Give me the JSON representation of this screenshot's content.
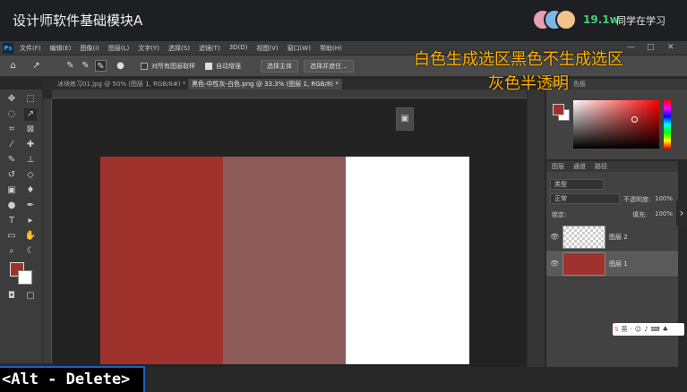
{
  "course": {
    "title": "设计师软件基础模块A"
  },
  "viewers": {
    "count": "19.1w",
    "label": "同学在学习"
  },
  "menu": {
    "logo": "Ps",
    "items": [
      "文件(F)",
      "编辑(E)",
      "图像(I)",
      "图层(L)",
      "文字(Y)",
      "选择(S)",
      "滤镜(T)",
      "3D(D)",
      "视图(V)",
      "窗口(W)",
      "帮助(H)"
    ]
  },
  "options": {
    "sample_all_layers": "对所有图层取样",
    "auto_enhance": "自动增强",
    "select_subject": "选择主体",
    "select_and_mask": "选择并遮住..."
  },
  "annotation": {
    "line1": "白色生成选区黑色不生成选区",
    "line2": "灰色半透明"
  },
  "tabs": [
    {
      "label": "冰块练习01.jpg @ 50% (图层 1, RGB/8#) *",
      "active": false
    },
    {
      "label": "黑色-中性灰-白色.png @ 33.3% (图层 1, RGB/8) *",
      "active": true
    }
  ],
  "document": {
    "colors": [
      "#a0322d",
      "#8f5b59",
      "#ffffff"
    ]
  },
  "color_panel": {
    "tabs": [
      "颜色",
      "色板"
    ],
    "foreground": "#a0322d",
    "background": "#ffffff"
  },
  "layers_panel": {
    "tabs": [
      "图层",
      "通道",
      "路径"
    ],
    "filter_kind": "类型",
    "blend_mode": "正常",
    "opacity_label": "不透明度:",
    "opacity_value": "100%",
    "lock_label": "锁定:",
    "fill_label": "填充:",
    "fill_value": "100%",
    "layers": [
      {
        "name": "图层 2",
        "selected": false
      },
      {
        "name": "图层 1",
        "selected": true
      }
    ]
  },
  "ime": {
    "lang": "英"
  },
  "shortcut": {
    "text": "<Alt - Delete>"
  },
  "icons": [
    "home-icon",
    "lasso-icon",
    "brush-icon",
    "eye-icon",
    "search-icon",
    "hand-icon",
    "zoom-icon"
  ]
}
